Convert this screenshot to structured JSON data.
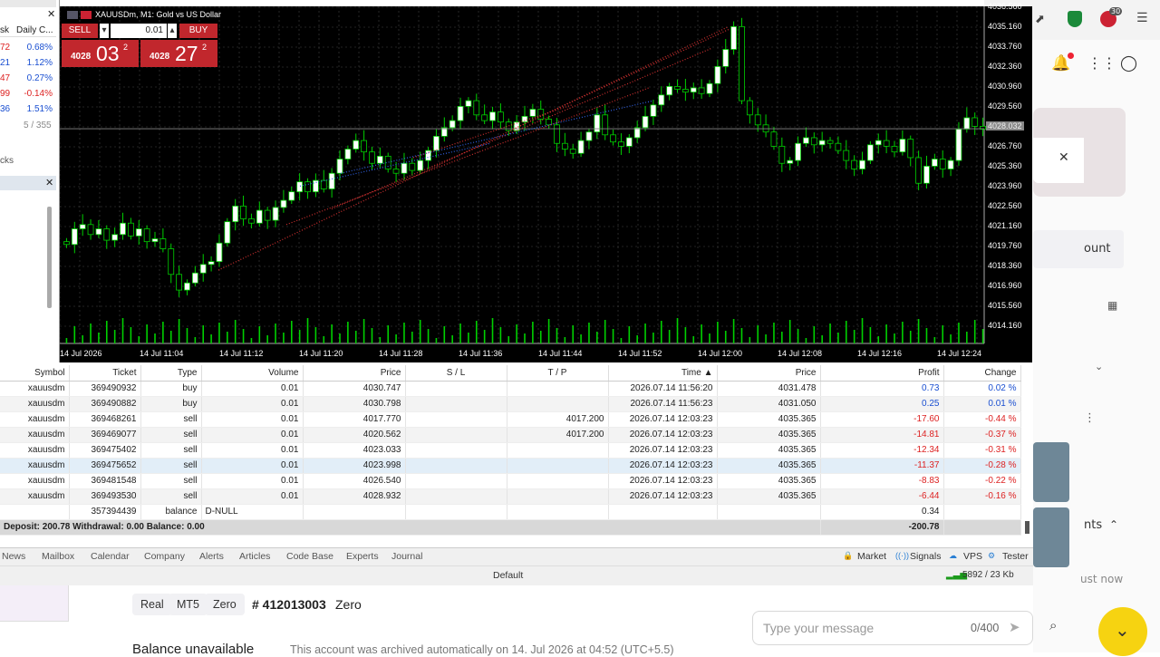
{
  "market_watch": {
    "header_sym": "sk",
    "header_change": "Daily C...",
    "rows": [
      {
        "bid": "72",
        "change": "0.68%",
        "bid_color": "#d22"
      },
      {
        "bid": "21",
        "change": "1.12%",
        "bid_color": "#1a4fd1"
      },
      {
        "bid": "47",
        "change": "0.27%",
        "bid_color": "#d22"
      },
      {
        "bid": "99",
        "change": "-0.14%",
        "bid_color": "#d22"
      },
      {
        "bid": "36",
        "change": "1.51%",
        "bid_color": "#1a4fd1"
      }
    ],
    "count": "5 / 355",
    "tab": "cks"
  },
  "chart": {
    "title": "XAUUSDm, M1:  Gold vs US Dollar",
    "one_click": {
      "sell_label": "SELL",
      "buy_label": "BUY",
      "lot": "0.01",
      "sell_big": "4028",
      "sell_main": "03",
      "sell_sup": "2",
      "buy_big": "4028",
      "buy_main": "27",
      "buy_sup": "2"
    },
    "price_labels": [
      "4036.560",
      "4035.160",
      "4033.760",
      "4032.360",
      "4030.960",
      "4029.560",
      "4028.032",
      "4026.760",
      "4025.360",
      "4023.960",
      "4022.560",
      "4021.160",
      "4019.760",
      "4018.360",
      "4016.960",
      "4015.560",
      "4014.160"
    ],
    "time_labels": [
      "14 Jul 2026",
      "14 Jul 11:04",
      "14 Jul 11:12",
      "14 Jul 11:20",
      "14 Jul 11:28",
      "14 Jul 11:36",
      "14 Jul 11:44",
      "14 Jul 11:52",
      "14 Jul 12:00",
      "14 Jul 12:08",
      "14 Jul 12:16",
      "14 Jul 12:24"
    ]
  },
  "trade": {
    "headers": [
      "Symbol",
      "Ticket",
      "Type",
      "Volume",
      "Price",
      "S / L",
      "T / P",
      "Time ▲",
      "Price",
      "Profit",
      "Change"
    ],
    "rows": [
      [
        "xauusdm",
        "369490932",
        "buy",
        "0.01",
        "4030.747",
        "",
        "",
        "2026.07.14 11:56:20",
        "4031.478",
        "0.73",
        "0.02 %"
      ],
      [
        "xauusdm",
        "369490882",
        "buy",
        "0.01",
        "4030.798",
        "",
        "",
        "2026.07.14 11:56:23",
        "4031.050",
        "0.25",
        "0.01 %"
      ],
      [
        "xauusdm",
        "369468261",
        "sell",
        "0.01",
        "4017.770",
        "",
        "4017.200",
        "2026.07.14 12:03:23",
        "4035.365",
        "-17.60",
        "-0.44 %"
      ],
      [
        "xauusdm",
        "369469077",
        "sell",
        "0.01",
        "4020.562",
        "",
        "4017.200",
        "2026.07.14 12:03:23",
        "4035.365",
        "-14.81",
        "-0.37 %"
      ],
      [
        "xauusdm",
        "369475402",
        "sell",
        "0.01",
        "4023.033",
        "",
        "",
        "2026.07.14 12:03:23",
        "4035.365",
        "-12.34",
        "-0.31 %"
      ],
      [
        "xauusdm",
        "369475652",
        "sell",
        "0.01",
        "4023.998",
        "",
        "",
        "2026.07.14 12:03:23",
        "4035.365",
        "-11.37",
        "-0.28 %"
      ],
      [
        "xauusdm",
        "369481548",
        "sell",
        "0.01",
        "4026.540",
        "",
        "",
        "2026.07.14 12:03:23",
        "4035.365",
        "-8.83",
        "-0.22 %"
      ],
      [
        "xauusdm",
        "369493530",
        "sell",
        "0.01",
        "4028.932",
        "",
        "",
        "2026.07.14 12:03:23",
        "4035.365",
        "-6.44",
        "-0.16 %"
      ],
      [
        "",
        "357394439",
        "balance",
        "D-NULL",
        "",
        "",
        "",
        "",
        "",
        "0.34",
        ""
      ]
    ],
    "summary": "Deposit: 200.78  Withdrawal: 0.00  Balance: 0.00",
    "summary_profit": "-200.78"
  },
  "tabs": {
    "left": [
      "News",
      "Mailbox",
      "Calendar",
      "Company",
      "Alerts",
      "Articles",
      "Code Base",
      "Experts",
      "Journal"
    ],
    "right": [
      "Market",
      "Signals",
      "VPS",
      "Tester"
    ]
  },
  "status": {
    "profile": "Default",
    "traffic": "5892 / 23 Kb"
  },
  "web": {
    "tags": [
      "Real",
      "MT5",
      "Zero"
    ],
    "account_num": "# 412013003",
    "account_type": "Zero",
    "balance_title": "Balance unavailable",
    "balance_note": "This account was archived automatically on 14. Jul 2026 at 04:52 (UTC+5.5)",
    "msg_placeholder": "Type your message",
    "msg_counter": "0/400",
    "side_account": "ount",
    "side_nts": "nts",
    "side_time": "ust now",
    "badge": "30"
  },
  "colors": {
    "chart_bg": "#000000",
    "bull": "#ffffff",
    "volume": "#00d000",
    "sell": "#c1272d",
    "accent_yellow": "#f6d311"
  }
}
